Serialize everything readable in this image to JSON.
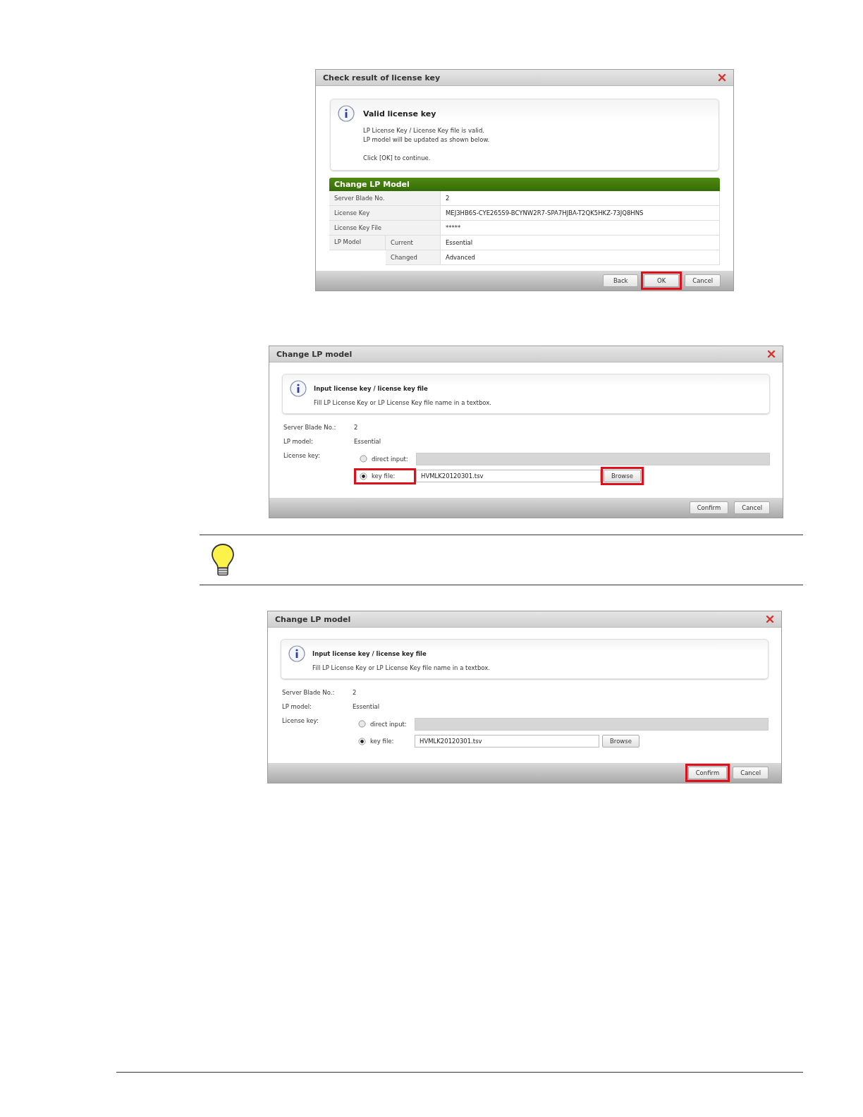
{
  "blocks": [
    {
      "kind": "result",
      "title": "Check result of license key",
      "info": {
        "heading": "Valid license key",
        "paragraphs": [
          [
            "LP License Key / License Key file is valid.",
            "LP model will be updated as shown below."
          ],
          [
            "Click [OK] to continue."
          ]
        ]
      },
      "panel": {
        "title": "Change LP Model",
        "rows": [
          {
            "label": "Server Blade No.",
            "value": "2"
          },
          {
            "label": "License Key",
            "value": "MEJ3HB6S-CYE265S9-BCYNW2R7-SPA7HJBA-T2QK5HKZ-73JQ8HNS"
          },
          {
            "label": "License Key File",
            "value": "*****"
          },
          {
            "label": "LP Model",
            "children": [
              {
                "label": "Current",
                "value": "Essential"
              },
              {
                "label": "Changed",
                "value": "Advanced"
              }
            ]
          }
        ]
      },
      "buttons": [
        {
          "label": "Back",
          "highlighted": false
        },
        {
          "label": "OK",
          "highlighted": true
        },
        {
          "label": "Cancel",
          "highlighted": false
        }
      ]
    },
    {
      "kind": "input",
      "title": "Change LP model",
      "info": {
        "heading": "Input license key / license key file",
        "lines": [
          "Fill LP License Key or LP License Key file name in a textbox."
        ]
      },
      "fields": [
        {
          "label": "Server Blade No.:",
          "value": "2"
        },
        {
          "label": "LP model:",
          "value": "Essential"
        }
      ],
      "license": {
        "label": "License key:",
        "options": [
          {
            "label": "direct input:",
            "selected": false,
            "highlighted": false,
            "disabled": true
          },
          {
            "label": "key file:",
            "selected": true,
            "highlighted": true,
            "disabled": false,
            "value": "HVMLK20120301.tsv",
            "browse": {
              "label": "Browse",
              "highlighted": true
            }
          }
        ]
      },
      "buttons": [
        {
          "label": "Confirm",
          "highlighted": false
        },
        {
          "label": "Cancel",
          "highlighted": false
        }
      ]
    },
    {
      "kind": "tip"
    },
    {
      "kind": "input",
      "title": "Change LP model",
      "info": {
        "heading": "Input license key / license key file",
        "lines": [
          "Fill LP License Key or LP License Key file name in a textbox."
        ]
      },
      "fields": [
        {
          "label": "Server Blade No.:",
          "value": "2"
        },
        {
          "label": "LP model:",
          "value": "Essential"
        }
      ],
      "license": {
        "label": "License key:",
        "options": [
          {
            "label": "direct input:",
            "selected": false,
            "highlighted": false,
            "disabled": true
          },
          {
            "label": "key file:",
            "selected": true,
            "highlighted": false,
            "disabled": false,
            "value": "HVMLK20120301.tsv",
            "browse": {
              "label": "Browse",
              "highlighted": false
            }
          }
        ]
      },
      "buttons": [
        {
          "label": "Confirm",
          "highlighted": true
        },
        {
          "label": "Cancel",
          "highlighted": false
        }
      ]
    }
  ]
}
